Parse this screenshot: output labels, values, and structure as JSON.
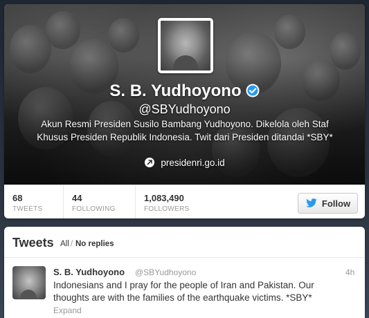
{
  "profile": {
    "name": "S. B. Yudhoyono",
    "screen_name": "@SBYudhoyono",
    "bio": "Akun Resmi Presiden Susilo Bambang Yudhoyono. Dikelola oleh Staf Khusus Presiden Republik Indonesia. Twit dari Presiden ditandai *SBY*",
    "website": "presidenri.go.id",
    "verified_icon": "verified-check-icon",
    "colors": {
      "verified": "#2a9af1",
      "header_text": "#ffffff"
    }
  },
  "stats": {
    "tweets": {
      "value": "68",
      "label": "TWEETS"
    },
    "following": {
      "value": "44",
      "label": "FOLLOWING"
    },
    "followers": {
      "value": "1,083,490",
      "label": "FOLLOWERS"
    }
  },
  "follow_button": {
    "label": "Follow",
    "icon": "twitter-bird-icon",
    "icon_color": "#2a9af1"
  },
  "tweets_section": {
    "title": "Tweets",
    "filter_all": "All",
    "filter_separator": "/",
    "filter_no_replies": "No replies"
  },
  "tweet": {
    "author": "S. B. Yudhoyono",
    "handle": "@SBYudhoyono",
    "time": "4h",
    "text": "Indonesians and I pray for the people of Iran and Pakistan. Our thoughts are with the families of the earthquake victims. *SBY*",
    "expand": "Expand"
  }
}
